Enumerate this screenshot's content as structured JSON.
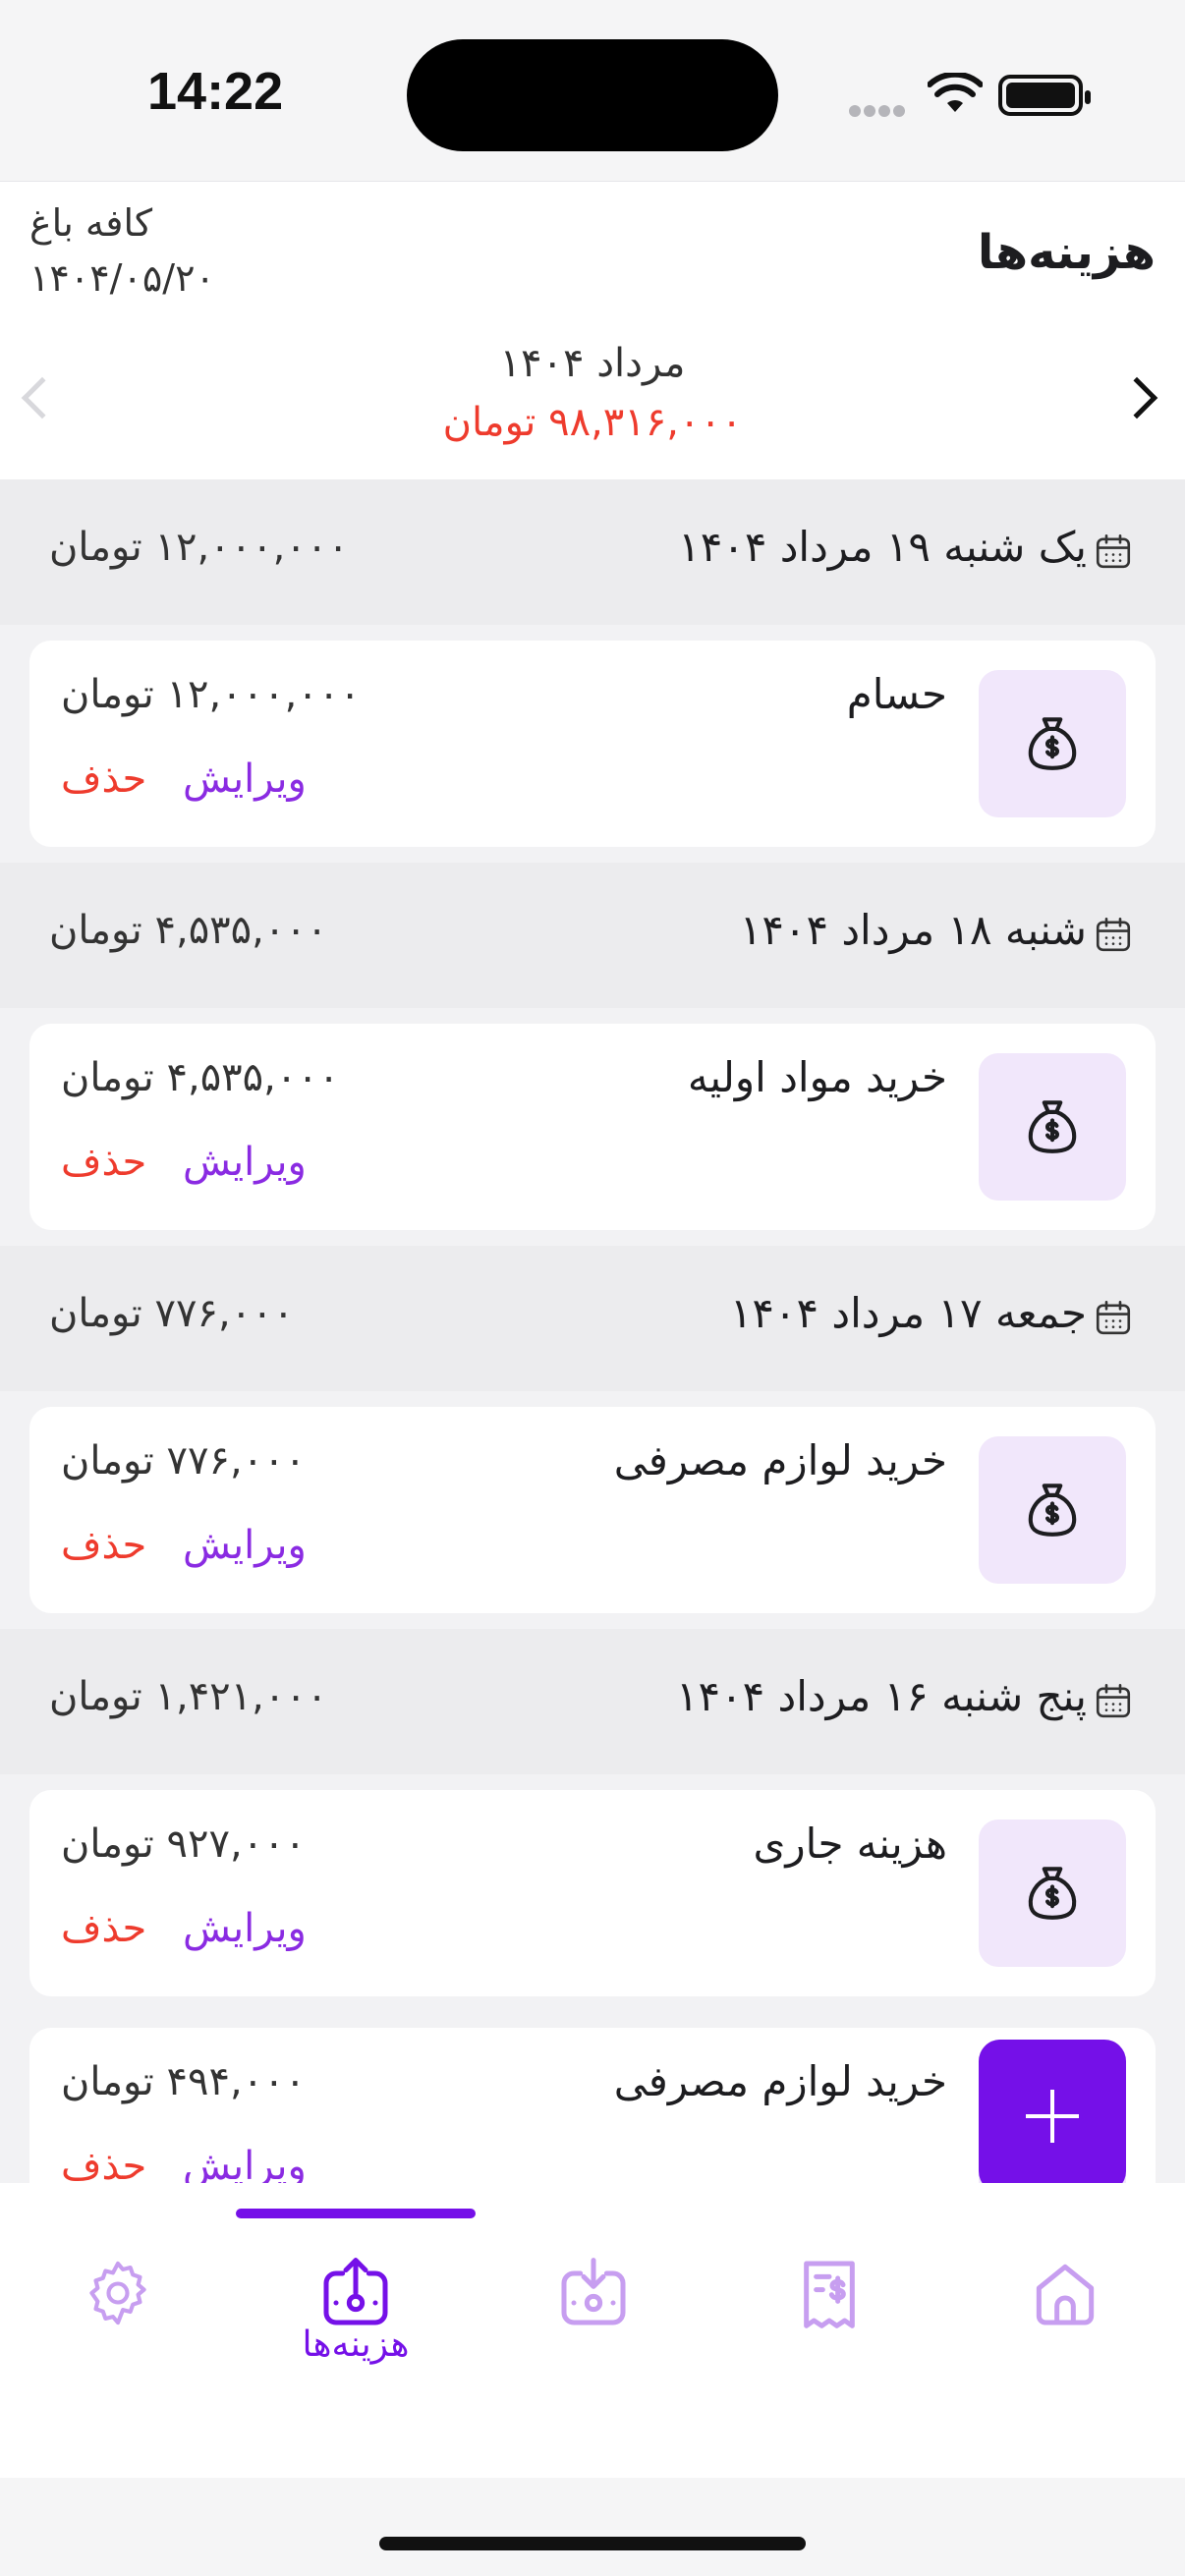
{
  "status": {
    "time": "14:22"
  },
  "header": {
    "title": "هزینه‌ها",
    "cafe_name": "کافه باغ",
    "cafe_date": "۱۴۰۴/۰۵/۲۰",
    "month_label": "مرداد ۱۴۰۴",
    "month_total": "۹۸,۳۱۶,۰۰۰ تومان"
  },
  "days": [
    {
      "title": "یک شنبه ۱۹ مرداد ۱۴۰۴",
      "total": "۱۲,۰۰۰,۰۰۰ تومان",
      "items": [
        {
          "title": "حسام",
          "amount": "۱۲,۰۰۰,۰۰۰ تومان",
          "edit": "ویرایش",
          "delete": "حذف"
        }
      ]
    },
    {
      "title": "شنبه ۱۸ مرداد ۱۴۰۴",
      "total": "۴,۵۳۵,۰۰۰ تومان",
      "items": [
        {
          "title": "خرید مواد اولیه",
          "amount": "۴,۵۳۵,۰۰۰ تومان",
          "edit": "ویرایش",
          "delete": "حذف"
        }
      ]
    },
    {
      "title": "جمعه ۱۷ مرداد ۱۴۰۴",
      "total": "۷۷۶,۰۰۰ تومان",
      "items": [
        {
          "title": "خرید لوازم مصرفی",
          "amount": "۷۷۶,۰۰۰ تومان",
          "edit": "ویرایش",
          "delete": "حذف"
        }
      ]
    },
    {
      "title": "پنج شنبه ۱۶ مرداد ۱۴۰۴",
      "total": "۱,۴۲۱,۰۰۰ تومان",
      "items": [
        {
          "title": "هزینه جاری",
          "amount": "۹۲۷,۰۰۰ تومان",
          "edit": "ویرایش",
          "delete": "حذف"
        },
        {
          "title": "خرید لوازم مصرفی",
          "amount": "۴۹۴,۰۰۰ تومان",
          "edit": "ویرایش",
          "delete": "حذف"
        }
      ]
    }
  ],
  "tabbar": {
    "active_label": "هزینه‌ها",
    "tabs": [
      "gear-icon",
      "expense-upload-icon",
      "income-download-icon",
      "receipt-icon",
      "home-icon"
    ]
  },
  "colors": {
    "accent": "#7510e8",
    "danger": "#ee3b2d",
    "icon_bg": "#f1e7fb"
  }
}
